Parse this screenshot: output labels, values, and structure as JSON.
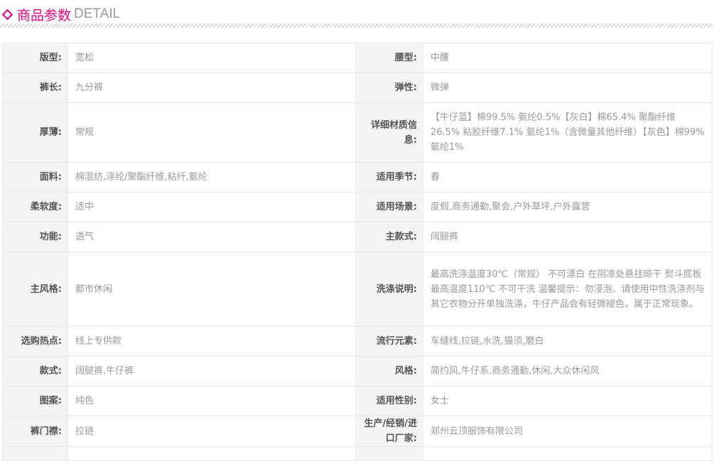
{
  "header": {
    "title_cn": "商品参数",
    "title_en": "DETAIL",
    "accent": "#e4007f"
  },
  "rows": [
    [
      {
        "label": "版型:",
        "value": "宽松"
      },
      {
        "label": "腰型:",
        "value": "中腰"
      }
    ],
    [
      {
        "label": "裤长:",
        "value": "九分裤"
      },
      {
        "label": "弹性:",
        "value": "微弹"
      }
    ],
    [
      {
        "label": "厚薄:",
        "value": "常规"
      },
      {
        "label": "详细材质信息:",
        "value": "【牛仔蓝】棉99.5% 氨纶0.5%【灰白】棉65.4% 聚酯纤维26.5% 粘胶纤维7.1% 氨纶1%（含微量其他纤维）【灰色】棉99% 氨纶1%"
      }
    ],
    [
      {
        "label": "面料:",
        "value": "棉混纺,涤纶/聚酯纤维,粘纤,氨纶"
      },
      {
        "label": "适用季节:",
        "value": "春"
      }
    ],
    [
      {
        "label": "柔软度:",
        "value": "适中"
      },
      {
        "label": "适用场景:",
        "value": "度假,商务通勤,聚会,户外草坪,户外露营"
      }
    ],
    [
      {
        "label": "功能:",
        "value": "透气"
      },
      {
        "label": "主款式:",
        "value": "阔腿裤"
      }
    ],
    [
      {
        "label": "主风格:",
        "value": "都市休闲"
      },
      {
        "label": "洗涤说明:",
        "value": "最高洗涤温度30℃（常规） 不可漂白 在阴凉处悬挂晾干 熨斗底板最高温度110℃ 不可干洗 温馨提示：勿浸泡、请使用中性洗涤剂与其它衣物分开单独洗涤，牛仔产品会有轻微褪色，属于正常现象。"
      }
    ],
    [
      {
        "label": "选购热点:",
        "value": "线上专供款"
      },
      {
        "label": "流行元素:",
        "value": "车缝线,拉链,水洗,猫须,磨白"
      }
    ],
    [
      {
        "label": "款式:",
        "value": "阔腿裤,牛仔裤"
      },
      {
        "label": "风格:",
        "value": "简约风,牛仔系,商务通勤,休闲,大众休闲风"
      }
    ],
    [
      {
        "label": "图案:",
        "value": "纯色"
      },
      {
        "label": "适用性别:",
        "value": "女士"
      }
    ],
    [
      {
        "label": "裤门襟:",
        "value": "拉链"
      },
      {
        "label": "生产/经销/进口厂家:",
        "value": "郑州云顶服饰有限公司"
      }
    ]
  ]
}
